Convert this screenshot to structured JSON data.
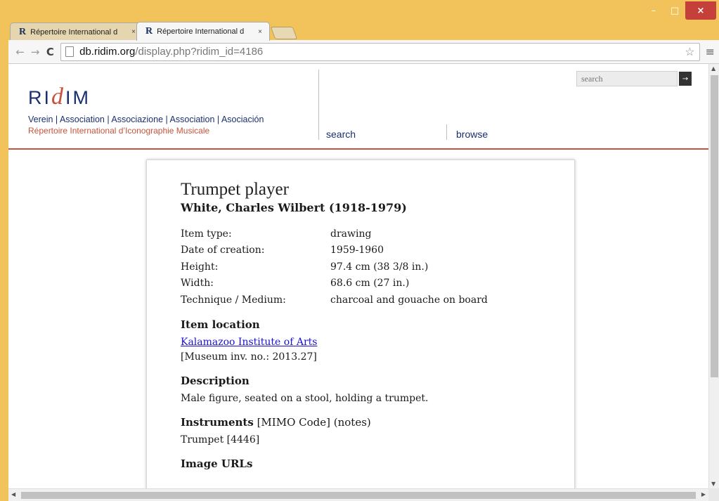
{
  "browser": {
    "tabs": [
      {
        "favicon": "R",
        "title": "Répertoire International d",
        "close": "×",
        "active": false
      },
      {
        "favicon": "R",
        "title": "Répertoire International d",
        "close": "×",
        "active": true
      }
    ],
    "window_controls": {
      "minimize": "–",
      "maximize": "□",
      "close": "×"
    },
    "url_domain": "db.ridim.org",
    "url_path": "/display.php?ridim_id=4186",
    "icons": {
      "back": "back-arrow-icon",
      "forward": "forward-arrow-icon",
      "reload": "reload-icon",
      "star": "star-icon",
      "menu": "menu-icon"
    }
  },
  "header": {
    "logo_text_left": "RI",
    "logo_text_curl": "d",
    "logo_text_right": "IM",
    "tagline1": "Verein | Association | Associazione | Association | Asociación",
    "tagline2": "Répertoire International d’Iconographie Musicale",
    "nav": {
      "search": "search",
      "browse": "browse"
    },
    "search_placeholder": "search",
    "search_go": "→"
  },
  "record": {
    "title": "Trumpet player",
    "artist": "White, Charles Wilbert (1918-1979)",
    "fields": [
      {
        "label": "Item type:",
        "value": "drawing"
      },
      {
        "label": "Date of creation:",
        "value": "1959-1960"
      },
      {
        "label": "Height:",
        "value": "97.4 cm  (38 3/8 in.)"
      },
      {
        "label": "Width:",
        "value": "68.6 cm  (27 in.)"
      },
      {
        "label": "Technique / Medium:",
        "value": "charcoal and gouache on board"
      }
    ],
    "location_heading": "Item location",
    "location_link": "Kalamazoo Institute of Arts",
    "location_inv": "[Museum inv. no.: 2013.27]",
    "description_heading": "Description",
    "description": "Male figure, seated on a stool, holding a trumpet.",
    "instruments_heading": "Instruments",
    "instruments_heading_extra": " [MIMO Code] (notes)",
    "instruments": "Trumpet [4446]",
    "image_urls_heading": "Image URLs"
  },
  "colors": {
    "brand_blue": "#1a2f6e",
    "brand_red": "#c8533c",
    "chrome_frame": "#f2c35a"
  }
}
